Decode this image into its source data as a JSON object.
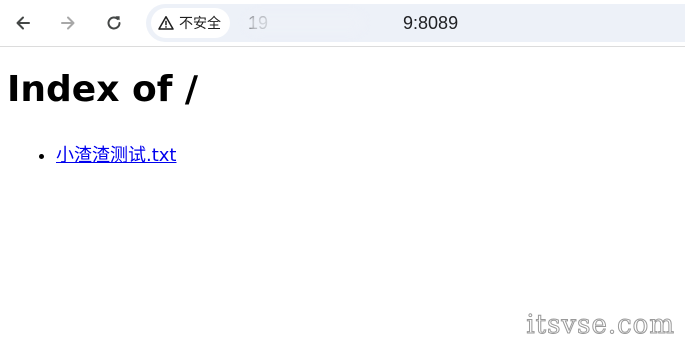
{
  "browser": {
    "back_icon": "arrow-left-icon",
    "forward_icon": "arrow-right-icon",
    "reload_icon": "reload-icon",
    "security_icon": "warning-triangle-icon",
    "security_label": "不安全",
    "url_visible": "19               9:8089",
    "url_suffix": ":8089",
    "omnibox_color": "#edf1f8"
  },
  "page": {
    "title": "Index of /",
    "files": [
      {
        "name": "小渣渣测试.txt"
      }
    ],
    "link_color": "#0000ee"
  },
  "watermark": "itsvse.com"
}
